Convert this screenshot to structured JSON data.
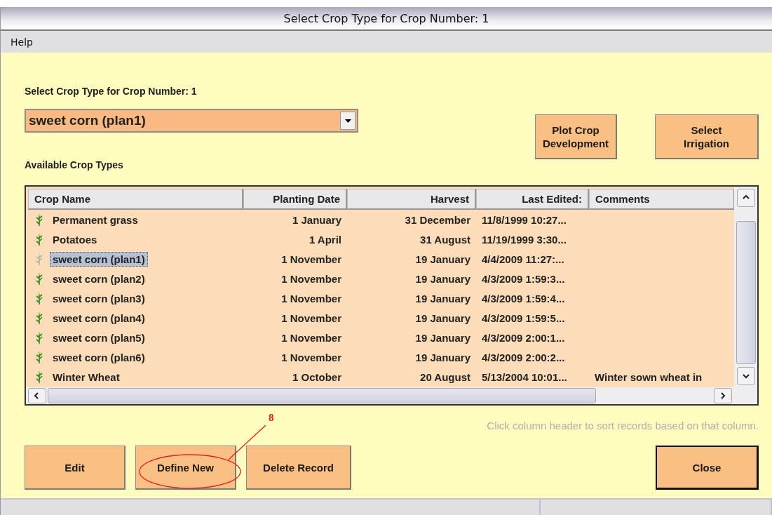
{
  "window": {
    "title": "Select Crop Type for Crop Number: 1"
  },
  "menu": [
    {
      "label": "Help"
    }
  ],
  "crop_label": "Select Crop Type for Crop Number: 1",
  "crop_select": {
    "value": "sweet corn (plan1)"
  },
  "list_label": "Available Crop Types",
  "side_buttons": [
    {
      "label": "Plot Crop Development"
    },
    {
      "label": "Select Irrigation"
    }
  ],
  "table": {
    "columns": [
      "Crop Name",
      "Planting Date",
      "Harvest",
      "Last Edited:",
      "Comments"
    ],
    "rows": [
      {
        "cells": [
          "Permanent grass",
          "1 January",
          "31 December",
          "11/8/1999 10:27...",
          ""
        ],
        "selected": false
      },
      {
        "cells": [
          "Potatoes",
          "1 April",
          "31 August",
          "11/19/1999 3:30...",
          ""
        ],
        "selected": false
      },
      {
        "cells": [
          "sweet corn (plan1)",
          "1 November",
          "19 January",
          "4/4/2009 11:27:...",
          ""
        ],
        "selected": true
      },
      {
        "cells": [
          "sweet corn (plan2)",
          "1 November",
          "19 January",
          "4/3/2009 1:59:3...",
          ""
        ],
        "selected": false
      },
      {
        "cells": [
          "sweet corn (plan3)",
          "1 November",
          "19 January",
          "4/3/2009 1:59:4...",
          ""
        ],
        "selected": false
      },
      {
        "cells": [
          "sweet corn (plan4)",
          "1 November",
          "19 January",
          "4/3/2009 1:59:5...",
          ""
        ],
        "selected": false
      },
      {
        "cells": [
          "sweet corn (plan5)",
          "1 November",
          "19 January",
          "4/3/2009 2:00:1...",
          ""
        ],
        "selected": false
      },
      {
        "cells": [
          "sweet corn (plan6)",
          "1 November",
          "19 January",
          "4/3/2009 2:00:2...",
          ""
        ],
        "selected": false
      },
      {
        "cells": [
          "Winter Wheat",
          "1 October",
          "20 August",
          "5/13/2004 10:01...",
          "Winter sown wheat in"
        ],
        "selected": false
      }
    ]
  },
  "hint": "Click column header to sort records based on that column.",
  "buttons": [
    {
      "label": "Edit",
      "default": false
    },
    {
      "label": "Define New",
      "default": false
    },
    {
      "label": "Delete Record",
      "default": false
    },
    {
      "label": "Close",
      "default": true
    }
  ],
  "annotation": {
    "label": "8"
  }
}
